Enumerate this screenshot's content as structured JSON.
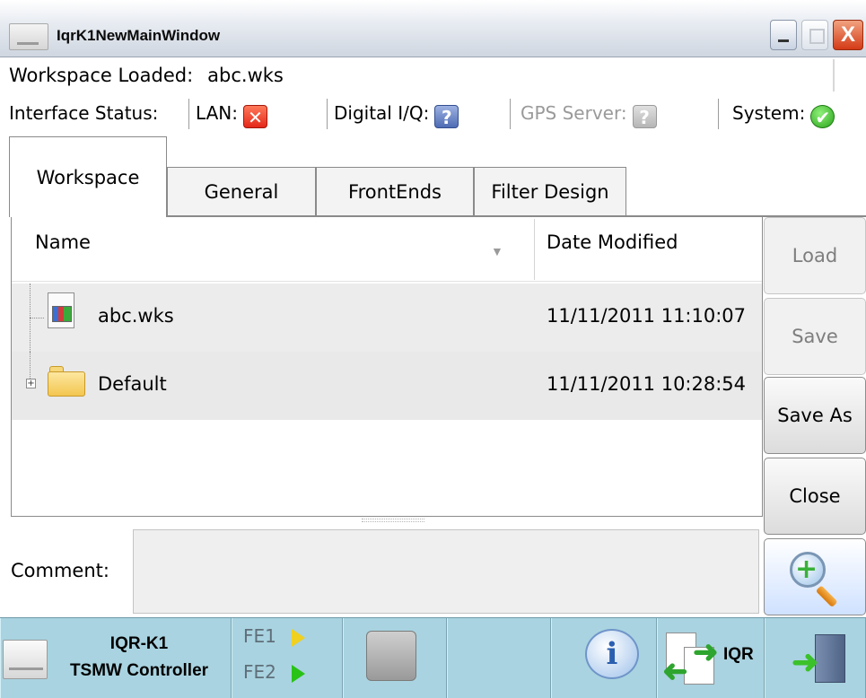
{
  "window": {
    "title": "IqrK1NewMainWindow",
    "close_glyph": "X"
  },
  "workspace": {
    "label": "Workspace Loaded:",
    "value": "abc.wks"
  },
  "status": {
    "label": "Interface Status:",
    "lan": {
      "label": "LAN:",
      "icon": "error-icon",
      "glyph": "✕"
    },
    "digital_iq": {
      "label": "Digital I/Q:",
      "icon": "unknown-icon",
      "glyph": "?"
    },
    "gps_server": {
      "label": "GPS Server:",
      "icon": "unknown-disabled-icon",
      "glyph": "?"
    },
    "system": {
      "label": "System:",
      "icon": "ok-check-icon",
      "glyph": "✔"
    }
  },
  "tabs": [
    {
      "label": "Workspace",
      "active": true
    },
    {
      "label": "General",
      "active": false
    },
    {
      "label": "FrontEnds",
      "active": false
    },
    {
      "label": "Filter Design",
      "active": false
    }
  ],
  "file_list": {
    "columns": {
      "name": "Name",
      "date": "Date Modified"
    },
    "rows": [
      {
        "name": "abc.wks",
        "date": "11/11/2011 11:10:07",
        "type": "file"
      },
      {
        "name": "Default",
        "date": "11/11/2011 10:28:54",
        "type": "folder"
      }
    ]
  },
  "comment": {
    "label": "Comment:",
    "value": ""
  },
  "side_buttons": {
    "load": "Load",
    "save": "Save",
    "save_as": "Save As",
    "close": "Close"
  },
  "toolbar": {
    "controller_line1": "IQR-K1",
    "controller_line2": "TSMW Controller",
    "fe1": "FE1",
    "fe2": "FE2",
    "iqr": "IQR"
  }
}
